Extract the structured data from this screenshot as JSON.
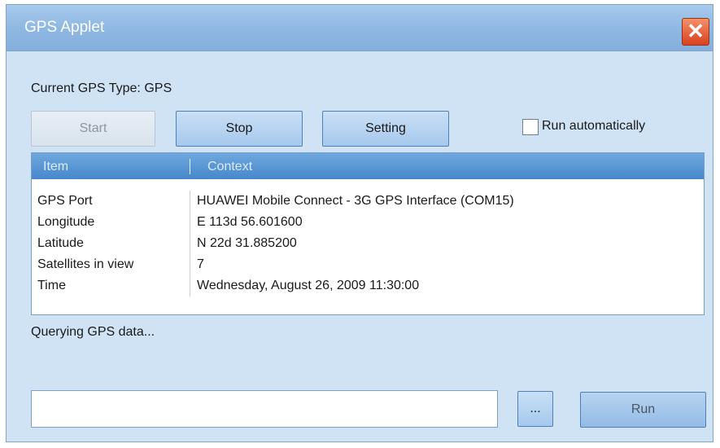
{
  "window": {
    "title": "GPS Applet",
    "close_icon": "close-icon"
  },
  "gps_type": {
    "label": "Current GPS Type: GPS"
  },
  "toolbar": {
    "start_label": "Start",
    "stop_label": "Stop",
    "setting_label": "Setting",
    "run_automatically_label": "Run automatically",
    "run_automatically_checked": false
  },
  "list": {
    "columns": [
      "Item",
      "Context"
    ],
    "rows": [
      {
        "item": "GPS Port",
        "context": "HUAWEI Mobile Connect - 3G GPS Interface (COM15)"
      },
      {
        "item": "Longitude",
        "context": "E 113d 56.601600"
      },
      {
        "item": "Latitude",
        "context": "N 22d 31.885200"
      },
      {
        "item": "Satellites in view",
        "context": "7"
      },
      {
        "item": "Time",
        "context": "Wednesday, August 26, 2009 11:30:00"
      }
    ]
  },
  "status": {
    "text": "Querying GPS data..."
  },
  "command": {
    "value": "",
    "browse_label": "...",
    "run_label": "Run"
  },
  "colors": {
    "window_bg": "#cfe3f5",
    "title_bar": "#8fb8e3",
    "list_header": "#4688cc",
    "close_button": "#d9411e"
  }
}
